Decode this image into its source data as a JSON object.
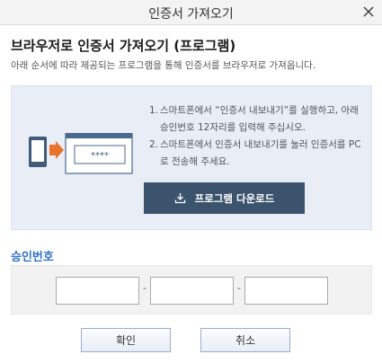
{
  "window": {
    "title": "인증서 가져오기"
  },
  "heading": "브라우저로 인증서 가져오기 (프로그램)",
  "subheading": "아래 순서에 따라 제공되는 프로그램을 통해 인증서를 브라우저로 가져옵니다.",
  "illustration": {
    "masked_code": "****"
  },
  "steps": [
    {
      "num": "1.",
      "text": "스마트폰에서 “인증서 내보내기”를 실행하고, 아래 승인번호 12자리를 입력해 주십시오."
    },
    {
      "num": "2.",
      "text": "스마트폰에서 인증서 내보내기를 눌러 인증서를 PC로 전송해 주세요."
    }
  ],
  "download_button": {
    "label": "프로그램 다운로드",
    "icon": "download-icon"
  },
  "approval": {
    "label": "승인번호",
    "separator": "-",
    "fields": [
      {
        "value": ""
      },
      {
        "value": ""
      },
      {
        "value": ""
      }
    ]
  },
  "buttons": {
    "confirm": "확인",
    "cancel": "취소"
  },
  "colors": {
    "accent": "#2f73c6",
    "download_bg": "#3b536c",
    "guide_bg": "#e8edf6",
    "arrow": "#e8742a"
  }
}
